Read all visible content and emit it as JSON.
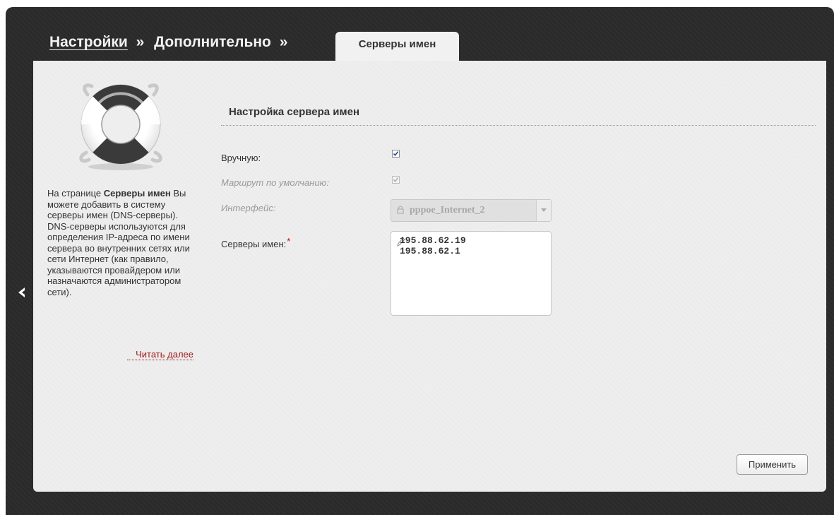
{
  "breadcrumb": {
    "settings": "Настройки",
    "separator": "»",
    "advanced": "Дополнительно"
  },
  "tab": {
    "label": "Серверы имен"
  },
  "help": {
    "intro": "На странице ",
    "page_name": "Серверы имен",
    "body": " Вы можете добавить в систему серверы имен (DNS-серверы). DNS-серверы используются для определения IP-адреса по имени сервера во внутренних сетях или сети Интернет (как правило, указываются провайдером или назначаются администратором сети).",
    "read_more": "Читать далее"
  },
  "section": {
    "title": "Настройка сервера имен"
  },
  "form": {
    "manual": {
      "label": "Вручную:",
      "checked": true
    },
    "default_route": {
      "label": "Маршрут по умолчанию:",
      "checked": true,
      "disabled": true
    },
    "interface": {
      "label": "Интерфейс:",
      "value": "pppoe_Internet_2",
      "disabled": true
    },
    "name_servers": {
      "label": "Серверы имен:",
      "required_mark": "*",
      "value": "195.88.62.19\n195.88.62.1"
    }
  },
  "buttons": {
    "apply": "Применить"
  },
  "icons": {
    "back": "chevron-left-icon",
    "help_image": "lifebuoy-icon",
    "interface_lock": "lock-icon",
    "select_arrow": "chevron-down-icon",
    "edit": "pencil-icon"
  },
  "colors": {
    "frame": "#2a2a2a",
    "panel": "#eeeeee",
    "link": "#a01818",
    "required": "#d10000"
  }
}
